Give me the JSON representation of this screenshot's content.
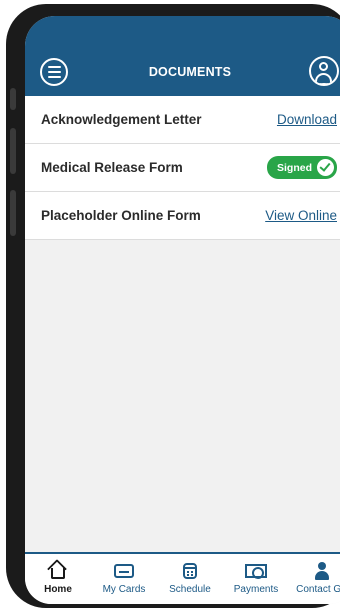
{
  "header": {
    "title": "DOCUMENTS",
    "menu_icon": "menu-icon",
    "profile_icon": "profile-icon"
  },
  "documents": [
    {
      "label": "Acknowledgement Letter",
      "action": "Download",
      "type": "link"
    },
    {
      "label": "Medical Release Form",
      "action": "Signed",
      "type": "badge"
    },
    {
      "label": "Placeholder Online Form",
      "action": "View Online",
      "type": "link"
    }
  ],
  "bottom_nav": [
    {
      "label": "Home",
      "icon": "home-icon",
      "active": true
    },
    {
      "label": "My Cards",
      "icon": "card-icon",
      "active": false
    },
    {
      "label": "Schedule",
      "icon": "calendar-icon",
      "active": false
    },
    {
      "label": "Payments",
      "icon": "money-icon",
      "active": false
    },
    {
      "label": "Contact GB",
      "icon": "person-icon",
      "active": false
    }
  ],
  "colors": {
    "brand": "#1d5a86",
    "signed": "#29a548",
    "background": "#f1f1f1"
  }
}
